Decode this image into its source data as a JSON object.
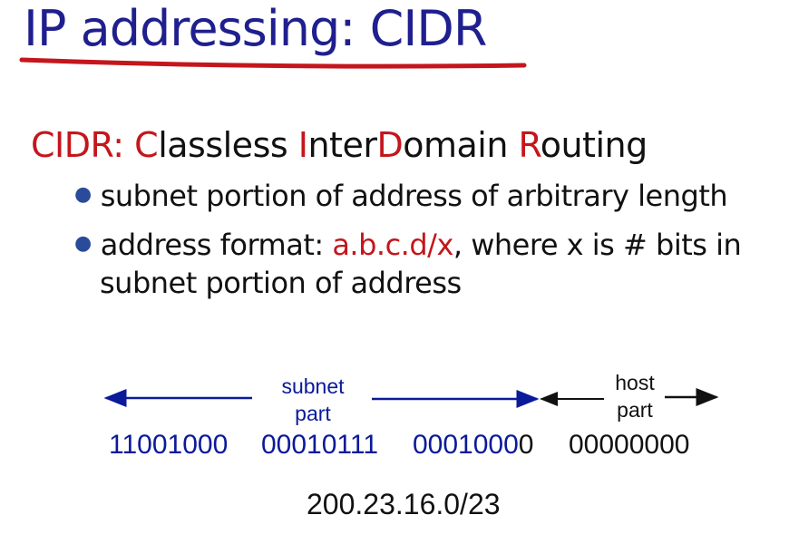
{
  "slide": {
    "title": "IP addressing: CIDR",
    "heading": {
      "c1": "C",
      "p1": "IDR: ",
      "c2": "C",
      "p2": "lassless ",
      "c3": "I",
      "p3": "nter",
      "c4": "D",
      "p4": "omain ",
      "c5": "R",
      "p5": "outing"
    },
    "bullets": [
      {
        "text": "subnet portion of address of arbitrary length"
      },
      {
        "pre": "address format: ",
        "highlight": "a.b.c.d/x",
        "post": ", where x is # bits in",
        "cont": "subnet portion of address"
      }
    ]
  },
  "diagram": {
    "subnet_label_1": "subnet",
    "subnet_label_2": "part",
    "host_label_1": "host",
    "host_label_2": "part",
    "octets": [
      "11001000",
      "00010111",
      "00010000",
      "00000000"
    ],
    "address": "200.23.16.0/23",
    "colors": {
      "subnet": "#0a1a9a",
      "host": "#111111",
      "accent": "#c4161c"
    }
  }
}
